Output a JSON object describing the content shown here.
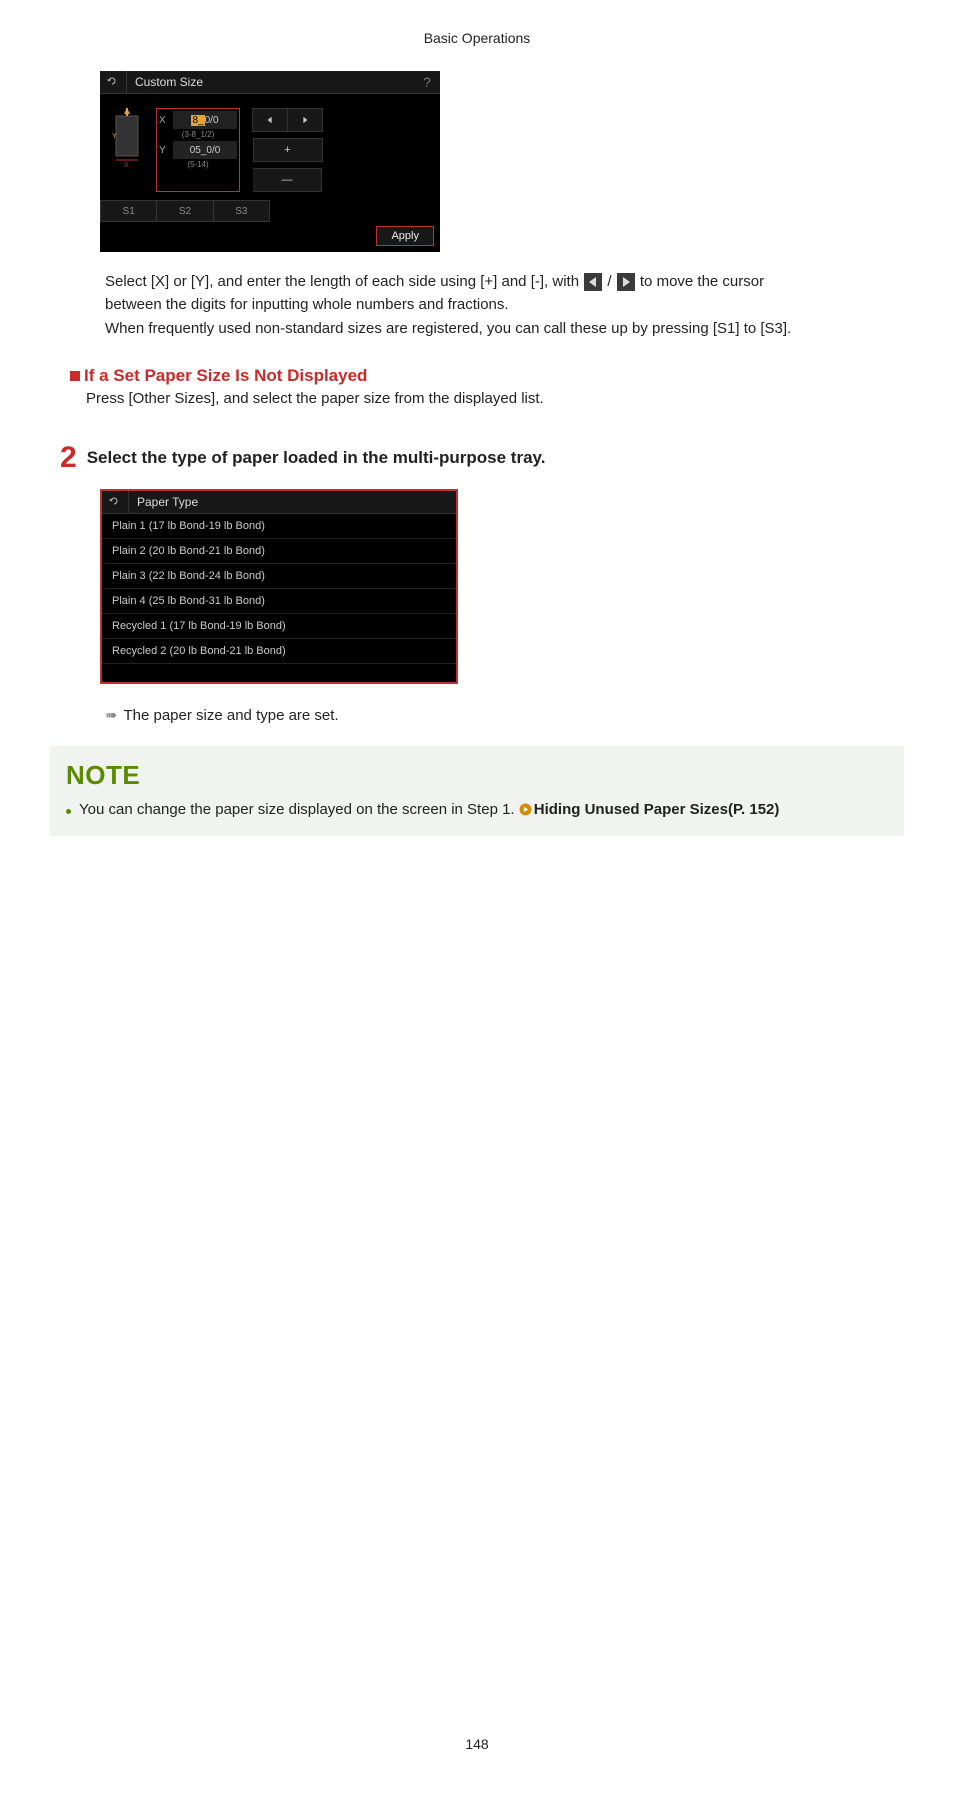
{
  "header": {
    "title": "Basic Operations"
  },
  "pageNumber": "148",
  "customSizePanel": {
    "title": "Custom Size",
    "help": "?",
    "x_label": "X",
    "y_label": "Y",
    "x_value_prefix": "8_",
    "x_value_suffix": "0/0",
    "x_range": "(3-8_1/2)",
    "y_value": "05_0/0",
    "y_range": "(5-14)",
    "s1": "S1",
    "s2": "S2",
    "s3": "S3",
    "apply": "Apply",
    "plus": "+",
    "minus": "—"
  },
  "customSizeInstructions": {
    "line1a": "Select [X] or [Y], and enter the length of each side using [+] and [-], with ",
    "line1b": " / ",
    "line1c": " to move the cursor",
    "line2": "between the digits for inputting whole numbers and fractions.",
    "line3": "When frequently used non-standard sizes are registered, you can call these up by pressing [S1] to [S3]."
  },
  "subSection": {
    "heading": "If a Set Paper Size Is Not Displayed",
    "body": "Press [Other Sizes], and select the paper size from the displayed list."
  },
  "step2": {
    "num": "2",
    "text": "Select the type of paper loaded in the multi-purpose tray."
  },
  "paperTypePanel": {
    "title": "Paper Type",
    "items": [
      "Plain 1 (17 lb Bond-19 lb Bond)",
      "Plain 2 (20 lb Bond-21 lb Bond)",
      "Plain 3 (22 lb Bond-24 lb Bond)",
      "Plain 4 (25 lb Bond-31 lb Bond)",
      "Recycled 1 (17 lb Bond-19 lb Bond)",
      "Recycled 2 (20 lb Bond-21 lb Bond)"
    ]
  },
  "resultLine": "The paper size and type are set.",
  "note": {
    "title": "NOTE",
    "bullet_pre": "You can change the paper size displayed on the screen in Step 1. ",
    "bullet_link": "Hiding Unused Paper Sizes(P. 152)"
  }
}
